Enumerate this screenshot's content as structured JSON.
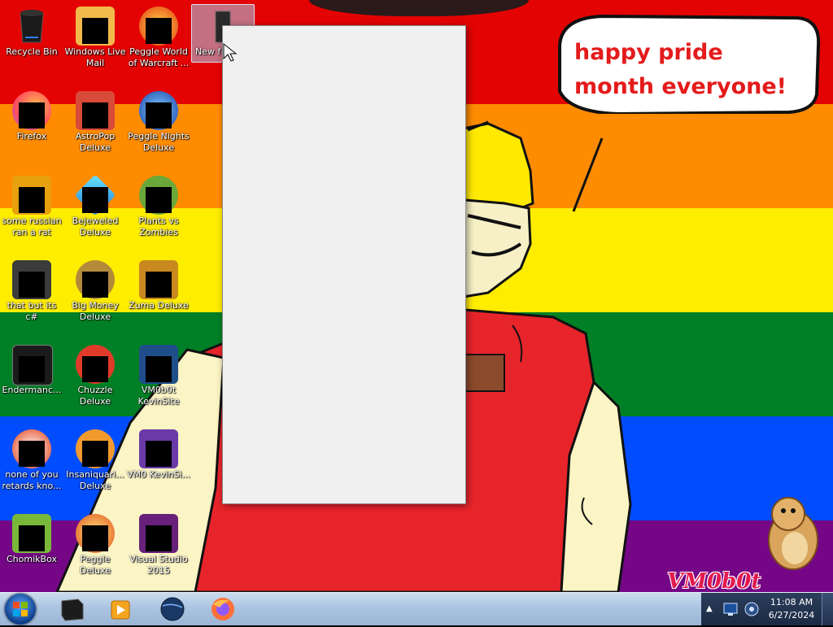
{
  "speech": {
    "text": "happy pride month everyone!"
  },
  "watermark": {
    "text": "VM0b0t"
  },
  "desktop_icons": [
    {
      "label": "Recycle Bin"
    },
    {
      "label": "Windows Live Mail"
    },
    {
      "label": "Peggle World of Warcraft ..."
    },
    {
      "label": "New f"
    },
    {
      "label": "Firefox"
    },
    {
      "label": "AstroPop Deluxe"
    },
    {
      "label": "Peggle Nights Deluxe"
    },
    {
      "label": "some russian ran a rat"
    },
    {
      "label": "Bejeweled Deluxe"
    },
    {
      "label": "Plants vs Zombies"
    },
    {
      "label": "that but its c#"
    },
    {
      "label": "Big Money Deluxe"
    },
    {
      "label": "Zuma Deluxe"
    },
    {
      "label": "Endermanc..."
    },
    {
      "label": "Chuzzle Deluxe"
    },
    {
      "label": "VM0b0t KevinSite"
    },
    {
      "label": "none of you retards kno..."
    },
    {
      "label": "Insaniquari... Deluxe"
    },
    {
      "label": "VM0 KevinSi..."
    },
    {
      "label": "ChomikBox"
    },
    {
      "label": "Peggle Deluxe"
    },
    {
      "label": "Visual Studio 2015"
    }
  ],
  "taskbar": {
    "clock_time": "11:08 AM",
    "clock_date": "6/27/2024"
  }
}
